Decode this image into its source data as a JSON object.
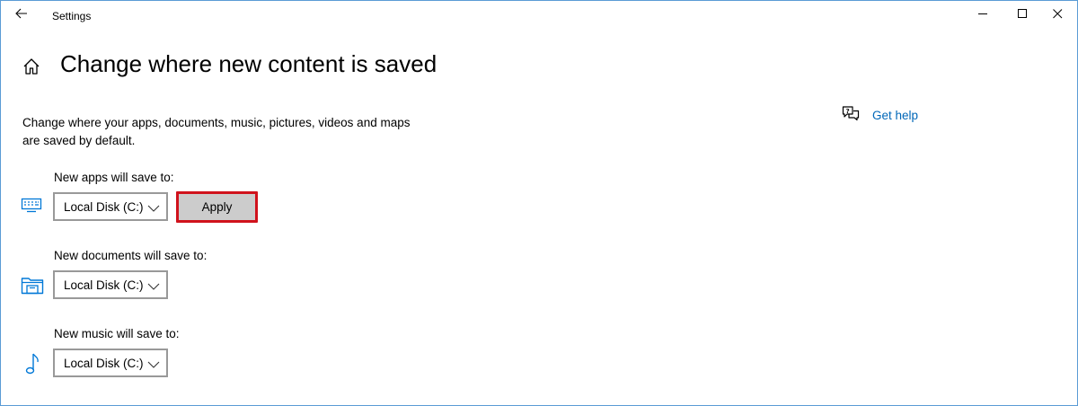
{
  "window": {
    "title": "Settings"
  },
  "header": {
    "page_title": "Change where new content is saved"
  },
  "description": "Change where your apps, documents, music, pictures, videos and maps are saved by default.",
  "help": {
    "label": "Get help"
  },
  "settings": [
    {
      "label": "New apps will save to:",
      "selected": "Local Disk (C:)",
      "icon": "monitor-icon"
    },
    {
      "label": "New documents will save to:",
      "selected": "Local Disk (C:)",
      "icon": "folder-icon"
    },
    {
      "label": "New music will save to:",
      "selected": "Local Disk (C:)",
      "icon": "music-note-icon"
    }
  ],
  "apply_button": {
    "label": "Apply"
  },
  "colors": {
    "accent": "#0067b8",
    "icon_blue": "#0078d7",
    "highlight_outline": "#d0121c",
    "button_gray": "#cccccc"
  }
}
